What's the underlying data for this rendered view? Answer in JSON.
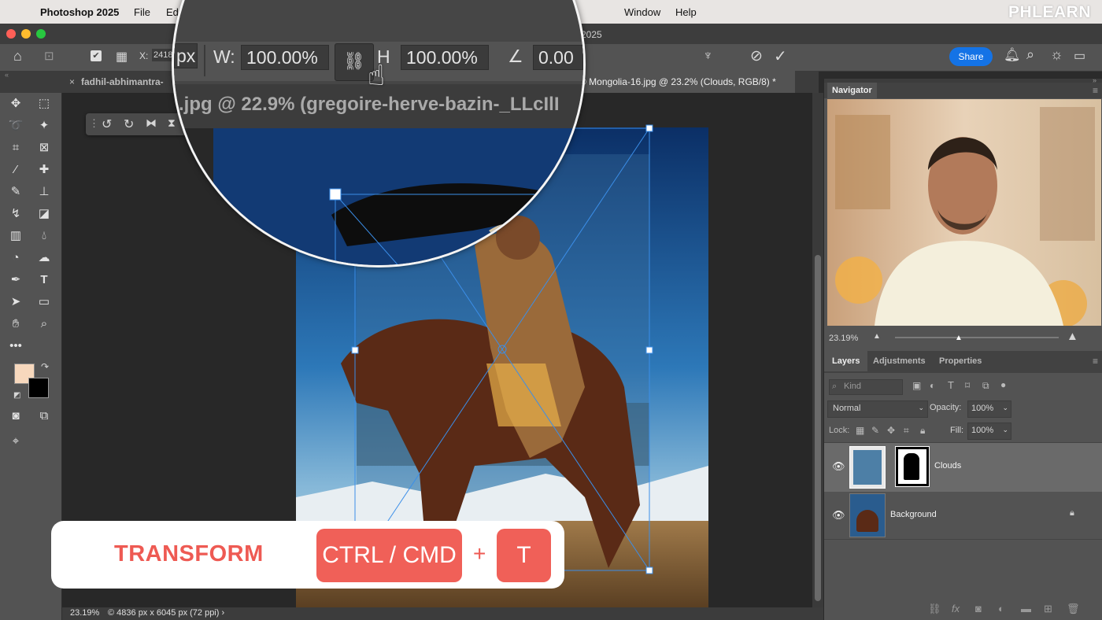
{
  "menubar": {
    "app_name": "Photoshop 2025",
    "items": [
      "File",
      "Ed",
      "Window",
      "Help"
    ],
    "brand_logo": "PHLEARN"
  },
  "window": {
    "title_fragment": "2025"
  },
  "options_bar": {
    "x_label": "X:",
    "x_value": "2418",
    "share_label": "Share"
  },
  "magnifier": {
    "x_unit": "px",
    "w_label": "W:",
    "w_value": "100.00%",
    "h_label": "H",
    "h_value": "100.00%",
    "angle_value": "0.00",
    "doc_title": ".jpg @ 22.9% (gregoire-herve-bazin-_LLcIlI"
  },
  "tabs": {
    "tab1": "fadhil-abhimantra-",
    "active": "© Mongolia-16.jpg @ 23.2% (Clouds, RGB/8) *"
  },
  "status": {
    "zoom": "23.19%",
    "doc_info": "© 4836 px x 6045 px (72 ppi) ›"
  },
  "navigator": {
    "title": "Navigator",
    "zoom": "23.19%"
  },
  "layers_panel": {
    "tabs": [
      "Layers",
      "Adjustments",
      "Properties"
    ],
    "kind_label": "Kind",
    "blend_mode": "Normal",
    "opacity_label": "Opacity:",
    "opacity_value": "100%",
    "lock_label": "Lock:",
    "fill_label": "Fill:",
    "fill_value": "100%",
    "layers": [
      {
        "name": "Clouds",
        "selected": true
      },
      {
        "name": "Background",
        "selected": false,
        "locked": true
      }
    ]
  },
  "overlay": {
    "transform_label": "TRANSFORM",
    "key1": "CTRL / CMD",
    "plus": "+",
    "key2": "T"
  },
  "colors": {
    "accent_blue": "#1473e6",
    "overlay_red": "#f06058",
    "foreground_swatch": "#f7d8bd",
    "background_swatch": "#000000"
  }
}
